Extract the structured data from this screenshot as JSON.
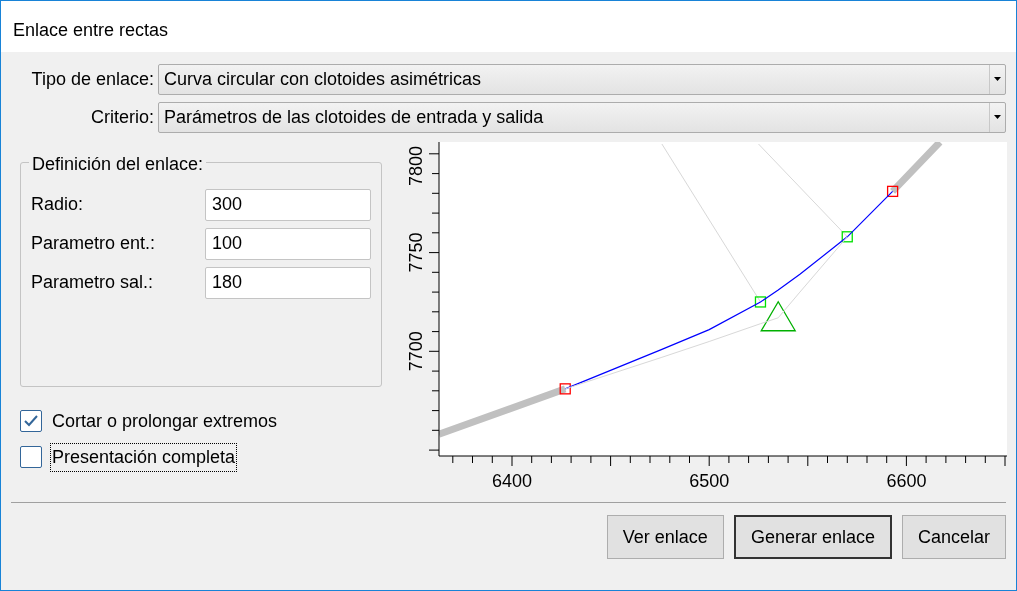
{
  "window": {
    "title": "Enlace entre rectas"
  },
  "selectors": [
    {
      "label": "Tipo de enlace:",
      "value": "Curva circular con clotoides asimétricas"
    },
    {
      "label": "Criterio:",
      "value": "Parámetros de las clotoides de entrada y salida"
    }
  ],
  "definition": {
    "title": "Definición del enlace:",
    "fields": [
      {
        "label": "Radio:",
        "value": "300"
      },
      {
        "label": "Parametro ent.:",
        "value": "100"
      },
      {
        "label": "Parametro sal.:",
        "value": "180"
      }
    ]
  },
  "options": [
    {
      "label": "Cortar o prolongar extremos",
      "checked": true,
      "focused": false
    },
    {
      "label": "Presentación completa",
      "checked": false,
      "focused": true
    }
  ],
  "plot": {
    "chart_data": {
      "type": "line",
      "x": [
        6363,
        6427,
        6476,
        6500,
        6526,
        6535,
        6546,
        6570,
        6593,
        6617
      ],
      "series": [
        {
          "color": "#c0c0c0",
          "values": [
            7658,
            7681,
            null,
            null,
            null,
            null,
            null,
            null,
            7781,
            7806
          ]
        },
        {
          "color": "#0000ff",
          "values": [
            null,
            7681,
            7701,
            7711,
            7725,
            7731,
            7739,
            7758,
            7781,
            null
          ]
        },
        {
          "color": "#d8d8d8",
          "values": [
            null,
            7681,
            7697,
            7705,
            7714,
            7717,
            7730,
            7758,
            null,
            null
          ]
        }
      ],
      "xlim": [
        6363,
        6651
      ],
      "ylim": [
        7647,
        7806
      ],
      "xticks": [
        6400,
        6500,
        6600
      ],
      "yticks": [
        7700,
        7750,
        7800
      ]
    }
  },
  "buttons": [
    {
      "label": "Ver enlace",
      "default": false
    },
    {
      "label": "Generar enlace",
      "default": true
    },
    {
      "label": "Cancelar",
      "default": false
    }
  ]
}
